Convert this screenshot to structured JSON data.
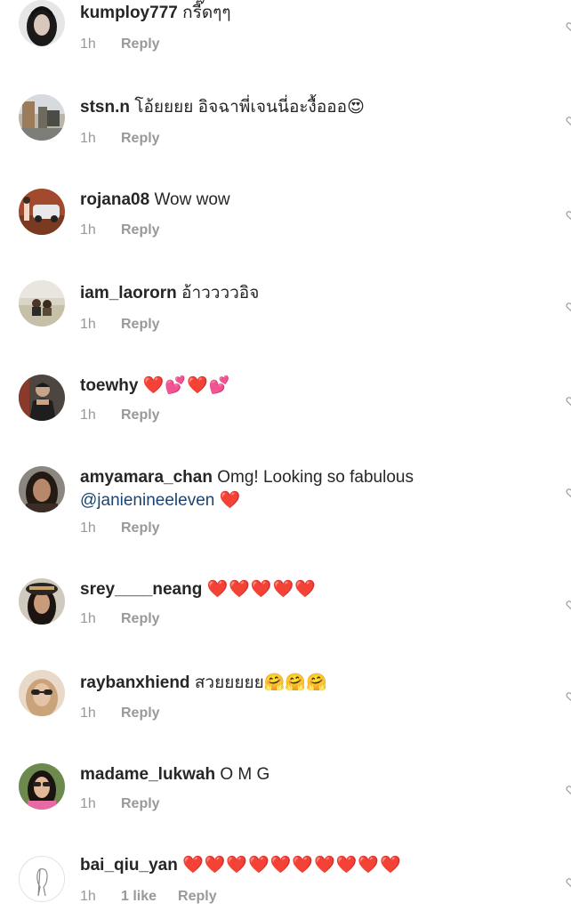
{
  "comments": [
    {
      "username": "kumploy777",
      "text": "กรี๊ดๆๆ",
      "time": "1h",
      "reply_label": "Reply",
      "avatar": "dark-hair"
    },
    {
      "username": "stsn.n",
      "text": "โอ้ยยยย อิจฉาพี่เจนนี่อะงื้อออ😍",
      "time": "1h",
      "reply_label": "Reply",
      "avatar": "street"
    },
    {
      "username": "rojana08",
      "text": "Wow wow",
      "time": "1h",
      "reply_label": "Reply",
      "avatar": "car"
    },
    {
      "username": "iam_laororn",
      "text": "อ้าววววอิจ",
      "time": "1h",
      "reply_label": "Reply",
      "avatar": "couple"
    },
    {
      "username": "toewhy",
      "text": "❤️💕❤️💕",
      "time": "1h",
      "reply_label": "Reply",
      "avatar": "man"
    },
    {
      "username": "amyamara_chan",
      "text": "Omg! Looking so fabulous",
      "mention": "@janienineeleven",
      "text_after": "❤️",
      "time": "1h",
      "reply_label": "Reply",
      "avatar": "woman-dark"
    },
    {
      "username": "srey____neang",
      "text": "❤️❤️❤️❤️❤️",
      "time": "1h",
      "reply_label": "Reply",
      "avatar": "woman-hat"
    },
    {
      "username": "raybanxhiend",
      "text": "สวยยยยย🤗🤗🤗",
      "time": "1h",
      "reply_label": "Reply",
      "avatar": "woman-sunglasses"
    },
    {
      "username": "madame_lukwah",
      "text": "O M G",
      "time": "1h",
      "reply_label": "Reply",
      "avatar": "woman-pink"
    },
    {
      "username": "bai_qiu_yan",
      "text": "❤️❤️❤️❤️❤️❤️❤️❤️❤️❤️",
      "time": "1h",
      "likes": "1 like",
      "reply_label": "Reply",
      "avatar": "default"
    }
  ],
  "colors": {
    "username": "#262626",
    "meta": "#999999",
    "mention": "#1c4470",
    "heart": "#e0192b"
  },
  "icons": {
    "like": "heart-outline-icon"
  }
}
